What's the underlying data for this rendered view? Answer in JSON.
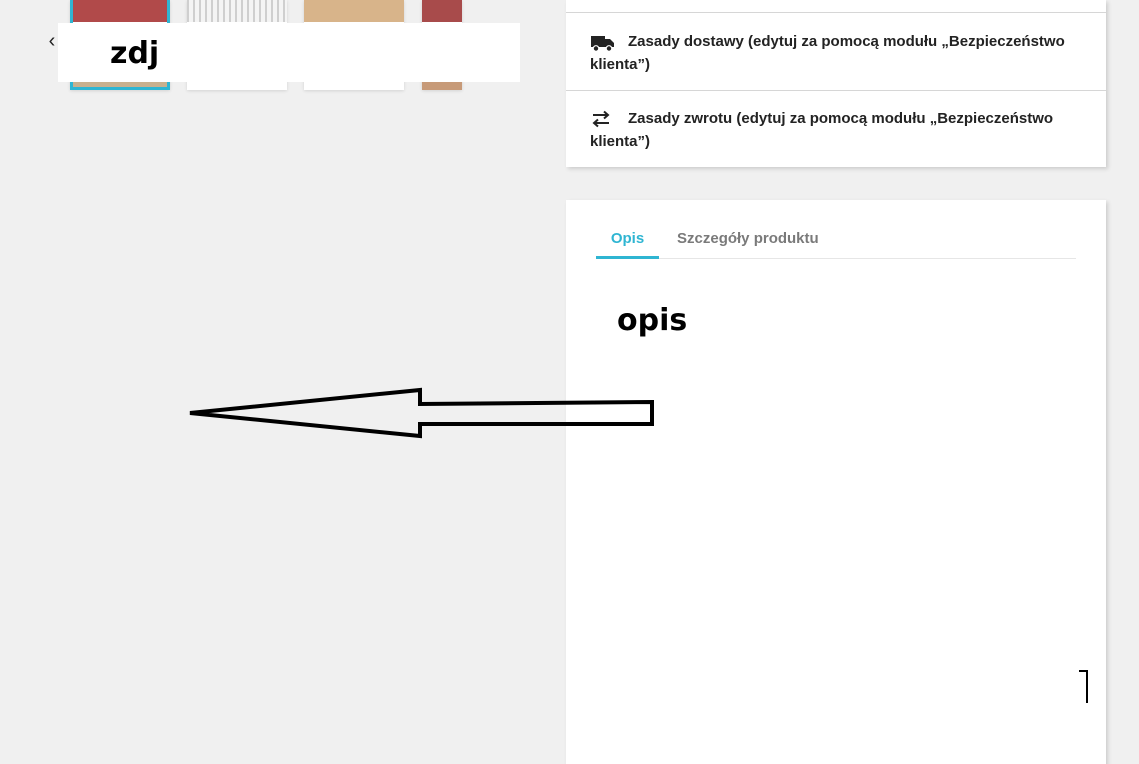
{
  "gallery": {
    "prev_icon": "chevron-left-icon",
    "prev_glyph": "‹",
    "overlay_label": "zdj",
    "thumbnails": [
      {
        "selected": true,
        "top_color": "#b14a4a",
        "bottom_color": "#c9b08e"
      },
      {
        "selected": false,
        "top_color": "#dcdcdc",
        "bottom_color": "#ffffff"
      },
      {
        "selected": false,
        "top_color": "#d8b48a",
        "bottom_color": "#ffffff"
      },
      {
        "selected": false,
        "top_color": "#a84b4b",
        "bottom_color": "#c79a78"
      }
    ]
  },
  "policies": [
    {
      "icon": "truck-icon",
      "text": "Zasady dostawy (edytuj za pomocą modułu „Bezpieczeństwo klienta”)"
    },
    {
      "icon": "swap-arrows-icon",
      "text": "Zasady zwrotu (edytuj za pomocą modułu „Bezpieczeństwo klienta”)"
    }
  ],
  "tabs": [
    {
      "label": "Opis",
      "active": true
    },
    {
      "label": "Szczegóły produktu",
      "active": false
    }
  ],
  "description": {
    "overlay_label": "opis"
  },
  "colors": {
    "accent": "#2fb5d2",
    "text": "#232323",
    "background": "#f0f0f0"
  }
}
